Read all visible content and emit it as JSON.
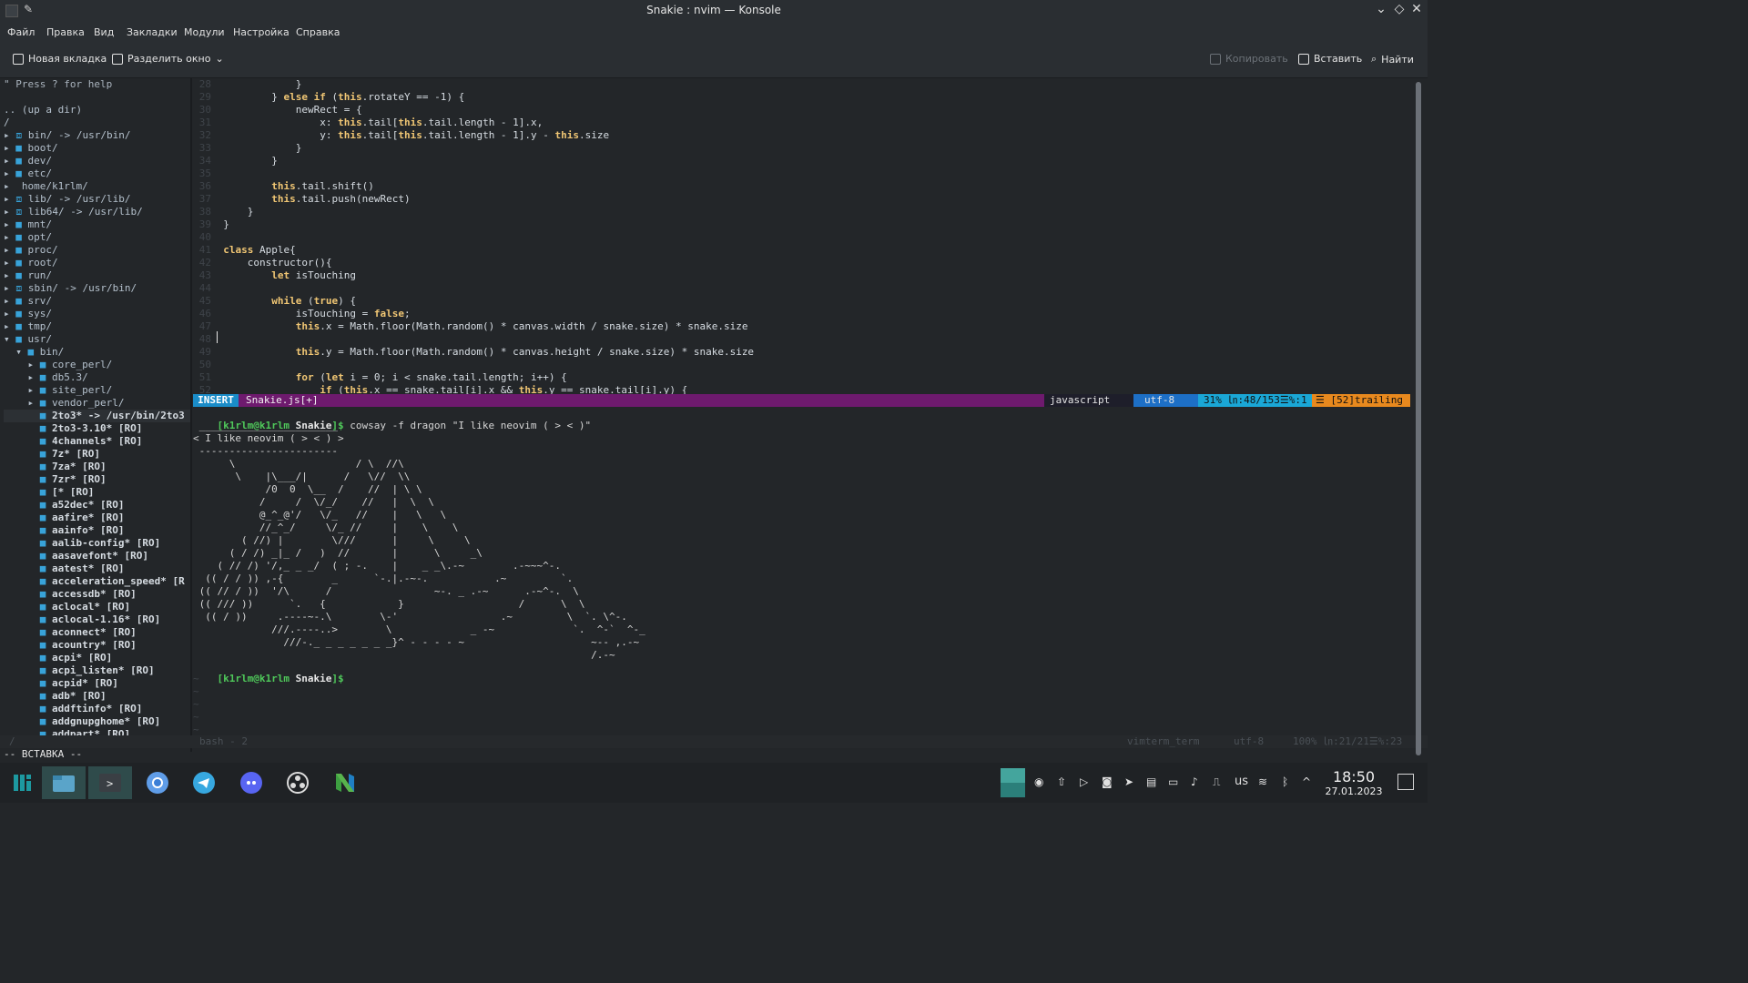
{
  "window": {
    "title": "Snakie : nvim — Konsole"
  },
  "menu": [
    "Файл",
    "Правка",
    "Вид",
    "Закладки",
    "Модули",
    "Настройка",
    "Справка"
  ],
  "toolbar": {
    "new_tab": "Новая вкладка",
    "split": "Разделить окно",
    "copy": "Копировать",
    "paste": "Вставить",
    "find": "Найти"
  },
  "tree": {
    "help": "\" Press ? for help",
    "up": ".. (up a dir)",
    "root": "/",
    "items": [
      {
        "a": "▸",
        "ico": "⧈",
        "name": "bin/ -> /usr/bin/",
        "cls": "dir"
      },
      {
        "a": "▸",
        "ico": "■",
        "name": "boot/",
        "cls": "dir"
      },
      {
        "a": "▸",
        "ico": "■",
        "name": "dev/",
        "cls": "dir"
      },
      {
        "a": "▸",
        "ico": "■",
        "name": "etc/",
        "cls": "dir"
      },
      {
        "a": "▸",
        "ico": "",
        "name": "home/k1rlm/",
        "cls": "dir"
      },
      {
        "a": "▸",
        "ico": "⧈",
        "name": "lib/ -> /usr/lib/",
        "cls": "dir"
      },
      {
        "a": "▸",
        "ico": "⧈",
        "name": "lib64/ -> /usr/lib/",
        "cls": "dir"
      },
      {
        "a": "▸",
        "ico": "■",
        "name": "mnt/",
        "cls": "dir"
      },
      {
        "a": "▸",
        "ico": "■",
        "name": "opt/",
        "cls": "dir"
      },
      {
        "a": "▸",
        "ico": "■",
        "name": "proc/",
        "cls": "dir"
      },
      {
        "a": "▸",
        "ico": "■",
        "name": "root/",
        "cls": "dir"
      },
      {
        "a": "▸",
        "ico": "■",
        "name": "run/",
        "cls": "dir"
      },
      {
        "a": "▸",
        "ico": "⧈",
        "name": "sbin/ -> /usr/bin/",
        "cls": "dir"
      },
      {
        "a": "▸",
        "ico": "■",
        "name": "srv/",
        "cls": "dir"
      },
      {
        "a": "▸",
        "ico": "■",
        "name": "sys/",
        "cls": "dir"
      },
      {
        "a": "▸",
        "ico": "■",
        "name": "tmp/",
        "cls": "dir"
      },
      {
        "a": "▾",
        "ico": "■",
        "name": "usr/",
        "cls": "dir"
      },
      {
        "a": "  ▾",
        "ico": "■",
        "name": "bin/",
        "cls": "dir"
      },
      {
        "a": "    ▸",
        "ico": "■",
        "name": "core_perl/",
        "cls": "dir"
      },
      {
        "a": "    ▸",
        "ico": "■",
        "name": "db5.3/",
        "cls": "dir"
      },
      {
        "a": "    ▸",
        "ico": "■",
        "name": "site_perl/",
        "cls": "dir"
      },
      {
        "a": "    ▸",
        "ico": "■",
        "name": "vendor_perl/",
        "cls": "dir"
      },
      {
        "a": "     ",
        "ico": "■",
        "name": "2to3* -> /usr/bin/2to3",
        "cls": "exe"
      },
      {
        "a": "     ",
        "ico": "■",
        "name": "2to3-3.10* [RO]",
        "cls": "exe"
      },
      {
        "a": "     ",
        "ico": "■",
        "name": "4channels* [RO]",
        "cls": "exe"
      },
      {
        "a": "     ",
        "ico": "■",
        "name": "7z* [RO]",
        "cls": "exe"
      },
      {
        "a": "     ",
        "ico": "■",
        "name": "7za* [RO]",
        "cls": "exe"
      },
      {
        "a": "     ",
        "ico": "■",
        "name": "7zr* [RO]",
        "cls": "exe"
      },
      {
        "a": "     ",
        "ico": "■",
        "name": "[* [RO]",
        "cls": "exe"
      },
      {
        "a": "     ",
        "ico": "■",
        "name": "a52dec* [RO]",
        "cls": "exe"
      },
      {
        "a": "     ",
        "ico": "■",
        "name": "aafire* [RO]",
        "cls": "exe"
      },
      {
        "a": "     ",
        "ico": "■",
        "name": "aainfo* [RO]",
        "cls": "exe"
      },
      {
        "a": "     ",
        "ico": "■",
        "name": "aalib-config* [RO]",
        "cls": "exe"
      },
      {
        "a": "     ",
        "ico": "■",
        "name": "aasavefont* [RO]",
        "cls": "exe"
      },
      {
        "a": "     ",
        "ico": "■",
        "name": "aatest* [RO]",
        "cls": "exe"
      },
      {
        "a": "     ",
        "ico": "■",
        "name": "acceleration_speed* [R",
        "cls": "exe"
      },
      {
        "a": "     ",
        "ico": "■",
        "name": "accessdb* [RO]",
        "cls": "exe"
      },
      {
        "a": "     ",
        "ico": "■",
        "name": "aclocal* [RO]",
        "cls": "exe"
      },
      {
        "a": "     ",
        "ico": "■",
        "name": "aclocal-1.16* [RO]",
        "cls": "exe"
      },
      {
        "a": "     ",
        "ico": "■",
        "name": "aconnect* [RO]",
        "cls": "exe"
      },
      {
        "a": "     ",
        "ico": "■",
        "name": "acountry* [RO]",
        "cls": "exe"
      },
      {
        "a": "     ",
        "ico": "■",
        "name": "acpi* [RO]",
        "cls": "exe"
      },
      {
        "a": "     ",
        "ico": "■",
        "name": "acpi_listen* [RO]",
        "cls": "exe"
      },
      {
        "a": "     ",
        "ico": "■",
        "name": "acpid* [RO]",
        "cls": "exe"
      },
      {
        "a": "     ",
        "ico": "■",
        "name": "adb* [RO]",
        "cls": "exe"
      },
      {
        "a": "     ",
        "ico": "■",
        "name": "addftinfo* [RO]",
        "cls": "exe"
      },
      {
        "a": "     ",
        "ico": "■",
        "name": "addgnupghome* [RO]",
        "cls": "exe"
      },
      {
        "a": "     ",
        "ico": "■",
        "name": "addpart* [RO]",
        "cls": "exe"
      }
    ]
  },
  "code": {
    "lines": [
      {
        "n": "28",
        "t": "            }"
      },
      {
        "n": "29",
        "t": "        } else if (this.rotateY == -1) {"
      },
      {
        "n": "30",
        "t": "            newRect = {"
      },
      {
        "n": "31",
        "t": "                x: this.tail[this.tail.length - 1].x,"
      },
      {
        "n": "32",
        "t": "                y: this.tail[this.tail.length - 1].y - this.size"
      },
      {
        "n": "33",
        "t": "            }"
      },
      {
        "n": "34",
        "t": "        }"
      },
      {
        "n": "35",
        "t": ""
      },
      {
        "n": "36",
        "t": "        this.tail.shift()"
      },
      {
        "n": "37",
        "t": "        this.tail.push(newRect)"
      },
      {
        "n": "38",
        "t": "    }"
      },
      {
        "n": "39",
        "t": "}"
      },
      {
        "n": "40",
        "t": ""
      },
      {
        "n": "41",
        "t": "class Apple{"
      },
      {
        "n": "42",
        "t": "    constructor(){"
      },
      {
        "n": "43",
        "t": "        let isTouching"
      },
      {
        "n": "44",
        "t": ""
      },
      {
        "n": "45",
        "t": "        while (true) {"
      },
      {
        "n": "46",
        "t": "            isTouching = false;"
      },
      {
        "n": "47",
        "t": "            this.x = Math.floor(Math.random() * canvas.width / snake.size) * snake.size"
      },
      {
        "n": "48",
        "t": ""
      },
      {
        "n": "49",
        "t": "            this.y = Math.floor(Math.random() * canvas.height / snake.size) * snake.size"
      },
      {
        "n": "50",
        "t": ""
      },
      {
        "n": "51",
        "t": "            for (let i = 0; i < snake.tail.length; i++) {"
      },
      {
        "n": "52",
        "t": "                if (this.x == snake.tail[i].x && this.y == snake.tail[i].y) {"
      }
    ]
  },
  "statusline": {
    "mode": "INSERT",
    "file": "Snakie.js[+]",
    "filetype": "javascript ",
    "encoding": "utf-8 ",
    "position": "31% ㏑:48/153☰%:1",
    "warning": "☰ [52]trailing"
  },
  "term": {
    "prompt_user": "[k1rlm@k1rlm ",
    "prompt_dir": "Snakie",
    "prompt_end": "]$",
    "command": " cowsay -f dragon \"I like neovim ( > < )\"",
    "output": [
      " _______________________",
      "< I like neovim ( > < ) >",
      " -----------------------",
      "      \\                    / \\  //\\",
      "       \\    |\\___/|      /   \\//  \\\\",
      "            /0  0  \\__  /    //  | \\ \\",
      "           /     /  \\/_/    //   |  \\  \\",
      "           @_^_@'/   \\/_   //    |   \\   \\",
      "           //_^_/     \\/_ //     |    \\    \\",
      "        ( //) |        \\///      |     \\     \\",
      "      ( / /) _|_ /   )  //       |      \\     _\\",
      "    ( // /) '/,_ _ _/  ( ; -.    |    _ _\\.-~        .-~~~^-.",
      "  (( / / )) ,-{        _      `-.|.-~-.           .~         `.",
      " (( // / ))  '/\\      /                 ~-. _ .-~      .-~^-.  \\",
      " (( /// ))      `.   {            }                   /      \\  \\",
      "  (( / ))     .----~-.\\        \\-'                 .~         \\  `. \\^-.",
      "             ///.----..>        \\             _ -~             `.  ^-`  ^-_",
      "               ///-._ _ _ _ _ _ _}^ - - - - ~                     ~-- ,.-~",
      "                                                                  /.-~"
    ],
    "tildes": [
      "~",
      "~",
      "~",
      "~",
      "~"
    ]
  },
  "bottom": {
    "left": "bash - 2",
    "tree_marker": "/",
    "term_label": "vimterm_term ",
    "encoding": "utf-8 ",
    "pos": "100% ㏑:21/21☰%:23",
    "mode": "-- ВСТАВКА --"
  },
  "taskbar": {
    "apps": [
      "launcher-icon",
      "files-icon",
      "terminal-icon",
      "chromium-icon",
      "telegram-icon",
      "discord-icon",
      "obs-icon",
      "neovim-icon"
    ],
    "lang": "us",
    "time": "18:50",
    "date": "27.01.2023"
  }
}
